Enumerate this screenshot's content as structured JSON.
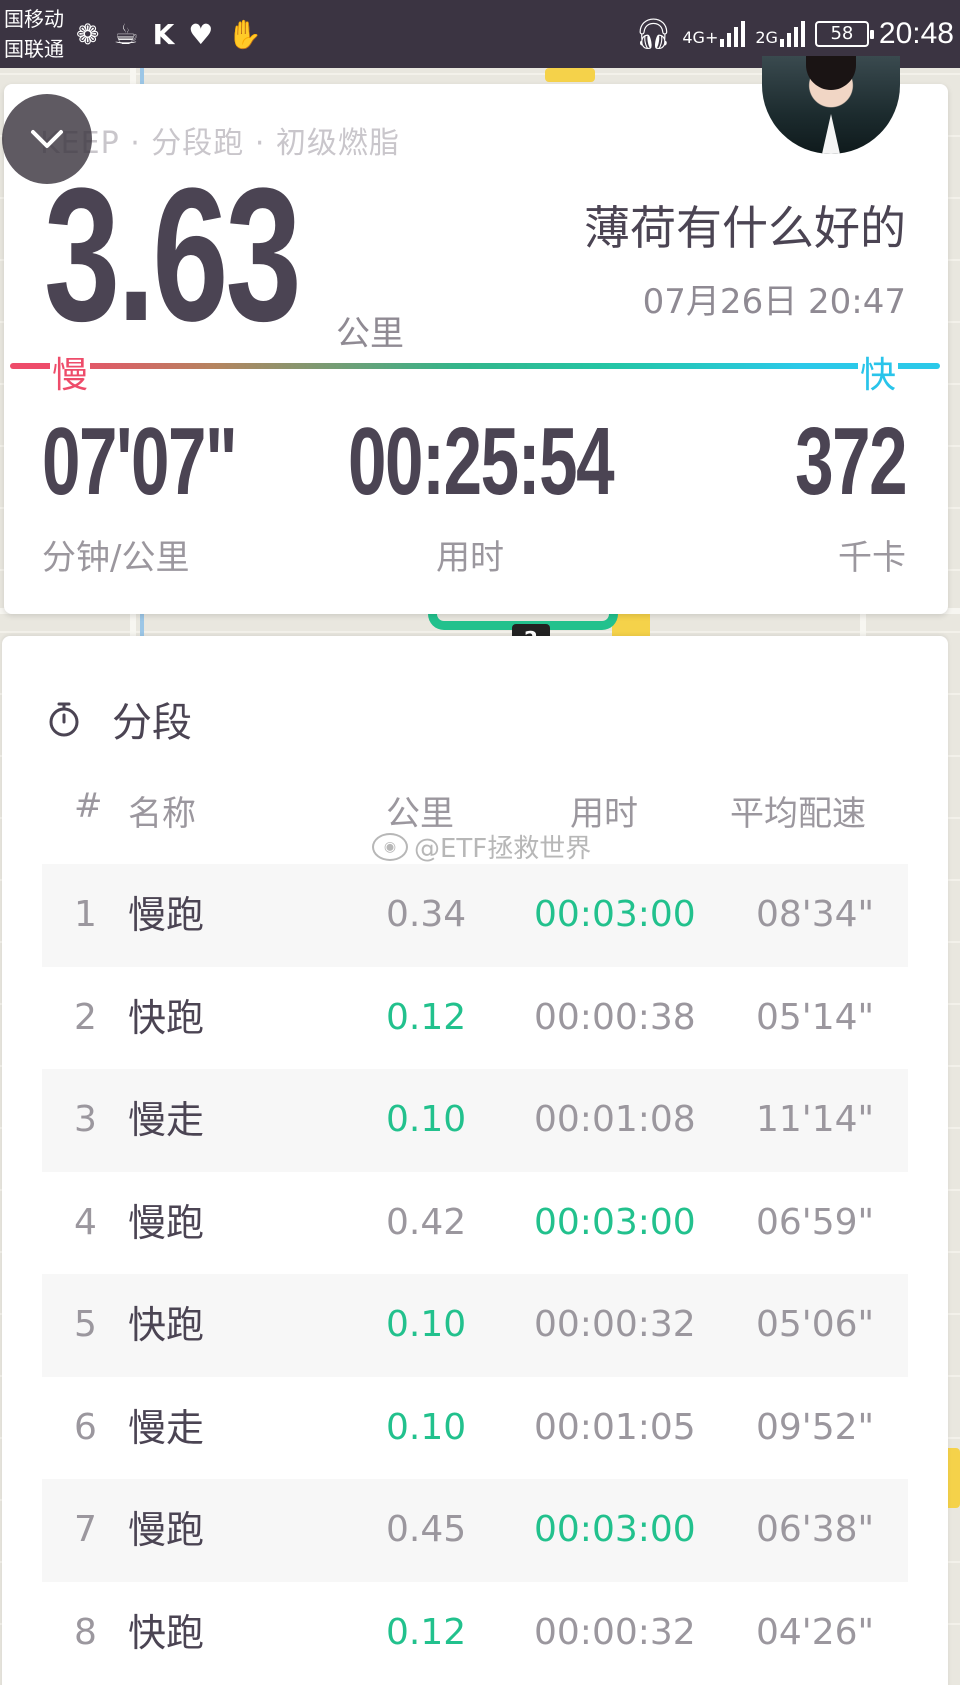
{
  "status_bar": {
    "carrier_1": "国移动",
    "carrier_2": "国联通",
    "network_4g": "4G+",
    "network_2g": "2G",
    "battery": "58",
    "time": "20:48"
  },
  "summary": {
    "subtitle": "KEEP · 分段跑 · 初级燃脂",
    "distance": "3.63",
    "distance_unit": "公里",
    "user_name": "薄荷有什么好的",
    "record_time": "07月26日 20:47",
    "pace_slow_label": "慢",
    "pace_fast_label": "快",
    "avg_pace": "07'07\"",
    "avg_pace_label": "分钟/公里",
    "duration": "00:25:54",
    "duration_label": "用时",
    "calories": "372",
    "calories_label": "千卡"
  },
  "map": {
    "route_marker": "2"
  },
  "segments": {
    "title": "分段",
    "columns": {
      "num": "#",
      "name": "名称",
      "km": "公里",
      "time": "用时",
      "pace": "平均配速"
    },
    "watermark": "@ETF拯救世界",
    "rows": [
      {
        "num": "1",
        "name": "慢跑",
        "km": "0.34",
        "time": "00:03:00",
        "pace": "08'34\""
      },
      {
        "num": "2",
        "name": "快跑",
        "km": "0.12",
        "time": "00:00:38",
        "pace": "05'14\""
      },
      {
        "num": "3",
        "name": "慢走",
        "km": "0.10",
        "time": "00:01:08",
        "pace": "11'14\""
      },
      {
        "num": "4",
        "name": "慢跑",
        "km": "0.42",
        "time": "00:03:00",
        "pace": "06'59\""
      },
      {
        "num": "5",
        "name": "快跑",
        "km": "0.10",
        "time": "00:00:32",
        "pace": "05'06\""
      },
      {
        "num": "6",
        "name": "慢走",
        "km": "0.10",
        "time": "00:01:05",
        "pace": "09'52\""
      },
      {
        "num": "7",
        "name": "慢跑",
        "km": "0.45",
        "time": "00:03:00",
        "pace": "06'38\""
      },
      {
        "num": "8",
        "name": "快跑",
        "km": "0.12",
        "time": "00:00:32",
        "pace": "04'26\""
      }
    ]
  },
  "colors": {
    "accent_green": "#22c18d",
    "slow_red": "#ee4c6a",
    "fast_cyan": "#29c4ea",
    "text_dark": "#4b4453"
  }
}
